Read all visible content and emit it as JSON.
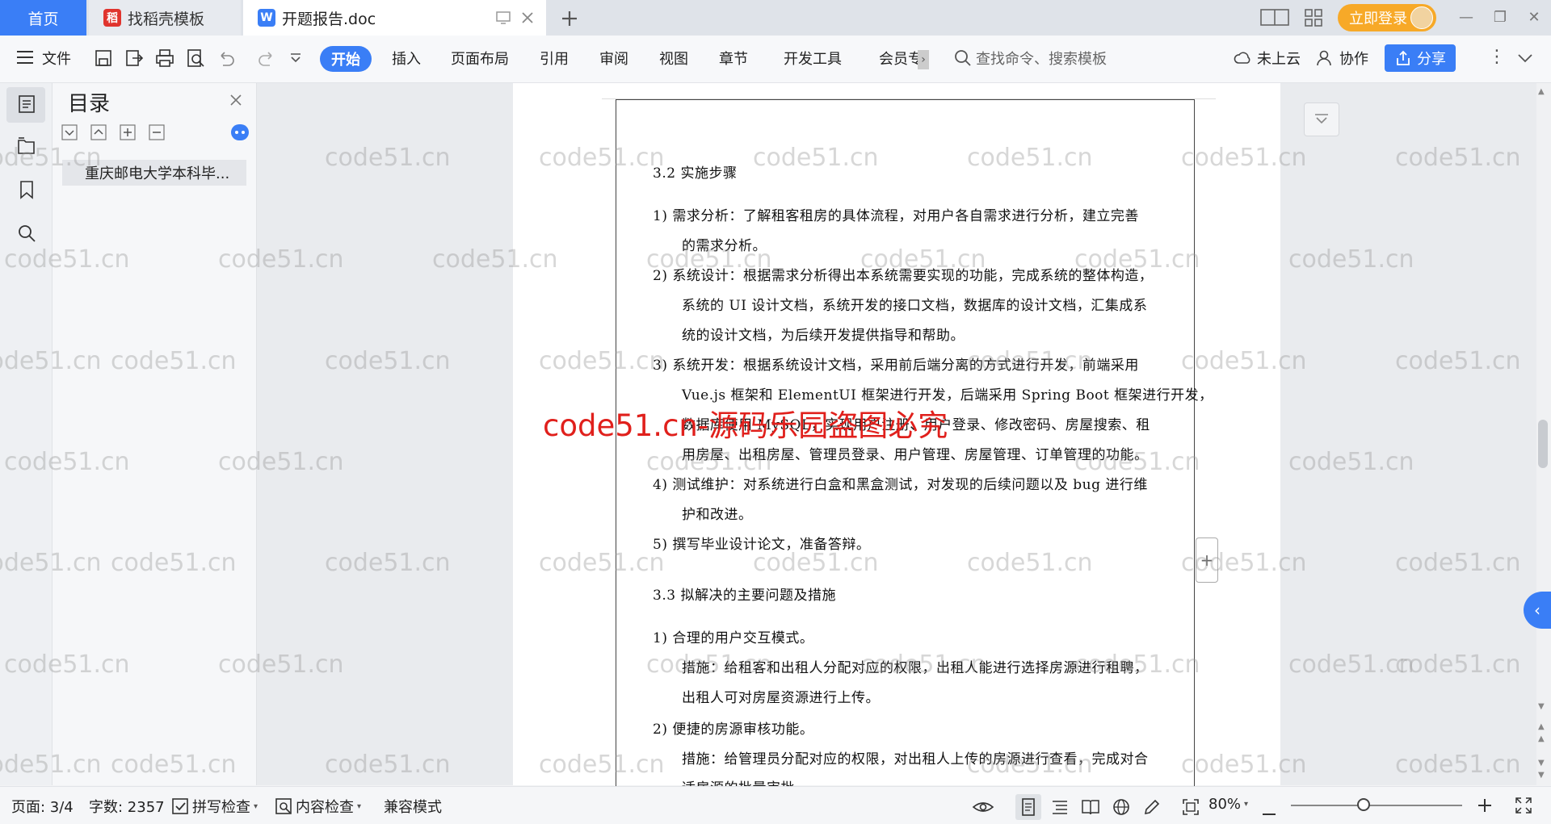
{
  "tabs": {
    "home": "首页",
    "templates": "找稻壳模板",
    "doc": "开题报告.doc"
  },
  "titlebar": {
    "login": "立即登录"
  },
  "toolbar": {
    "file": "文件",
    "start": "开始",
    "insert": "插入",
    "layout": "页面布局",
    "reference": "引用",
    "review": "审阅",
    "view": "视图",
    "chapter": "章节",
    "devtools": "开发工具",
    "member": "会员专",
    "search_placeholder": "查找命令、搜索模板",
    "cloud": "未上云",
    "collab": "协作",
    "share": "分享"
  },
  "outline": {
    "title": "目录",
    "items": [
      "重庆邮电大学本科毕..."
    ]
  },
  "document": {
    "lines": [
      "3.2 实施步骤",
      "1)  需求分析：了解租客租房的具体流程，对用户各自需求进行分析，建立完善",
      "的需求分析。",
      "2)  系统设计：根据需求分析得出本系统需要实现的功能，完成系统的整体构造，",
      "系统的 UI 设计文档，系统开发的接口文档，数据库的设计文档，汇集成系",
      "统的设计文档，为后续开发提供指导和帮助。",
      "3)  系统开发：根据系统设计文档，采用前后端分离的方式进行开发，前端采用",
      "Vue.js 框架和 ElementUI 框架进行开发，后端采用 Spring Boot 框架进行开发，",
      "数据库使用 MySQL，实现用户注册、用户登录、修改密码、房屋搜索、租",
      "用房屋、出租房屋、管理员登录、用户管理、房屋管理、订单管理的功能。",
      "4)  测试维护：对系统进行白盒和黑盒测试，对发现的后续问题以及 bug 进行维",
      "护和改进。",
      "5)  撰写毕业设计论文，准备答辩。",
      "3.3 拟解决的主要问题及措施",
      "1)  合理的用户交互模式。",
      "措施：给租客和出租人分配对应的权限，出租人能进行选择房源进行租聘，",
      "出租人可对房屋资源进行上传。",
      "2)  便捷的房源审核功能。",
      "措施：给管理员分配对应的权限，对出租人上传的房源进行查看，完成对合",
      "适房源的批量审批"
    ]
  },
  "watermark": {
    "text": "code51.cn",
    "big": "code51.cn-源码乐园盗图必究"
  },
  "status": {
    "page": "页面: 3/4",
    "words": "字数: 2357",
    "spellcheck": "拼写检查",
    "contentcheck": "内容检查",
    "compat": "兼容模式",
    "zoom": "80%"
  },
  "colors": {
    "accent": "#3a7ef6",
    "login": "#f7a928",
    "watermark_red": "#e0201c"
  }
}
